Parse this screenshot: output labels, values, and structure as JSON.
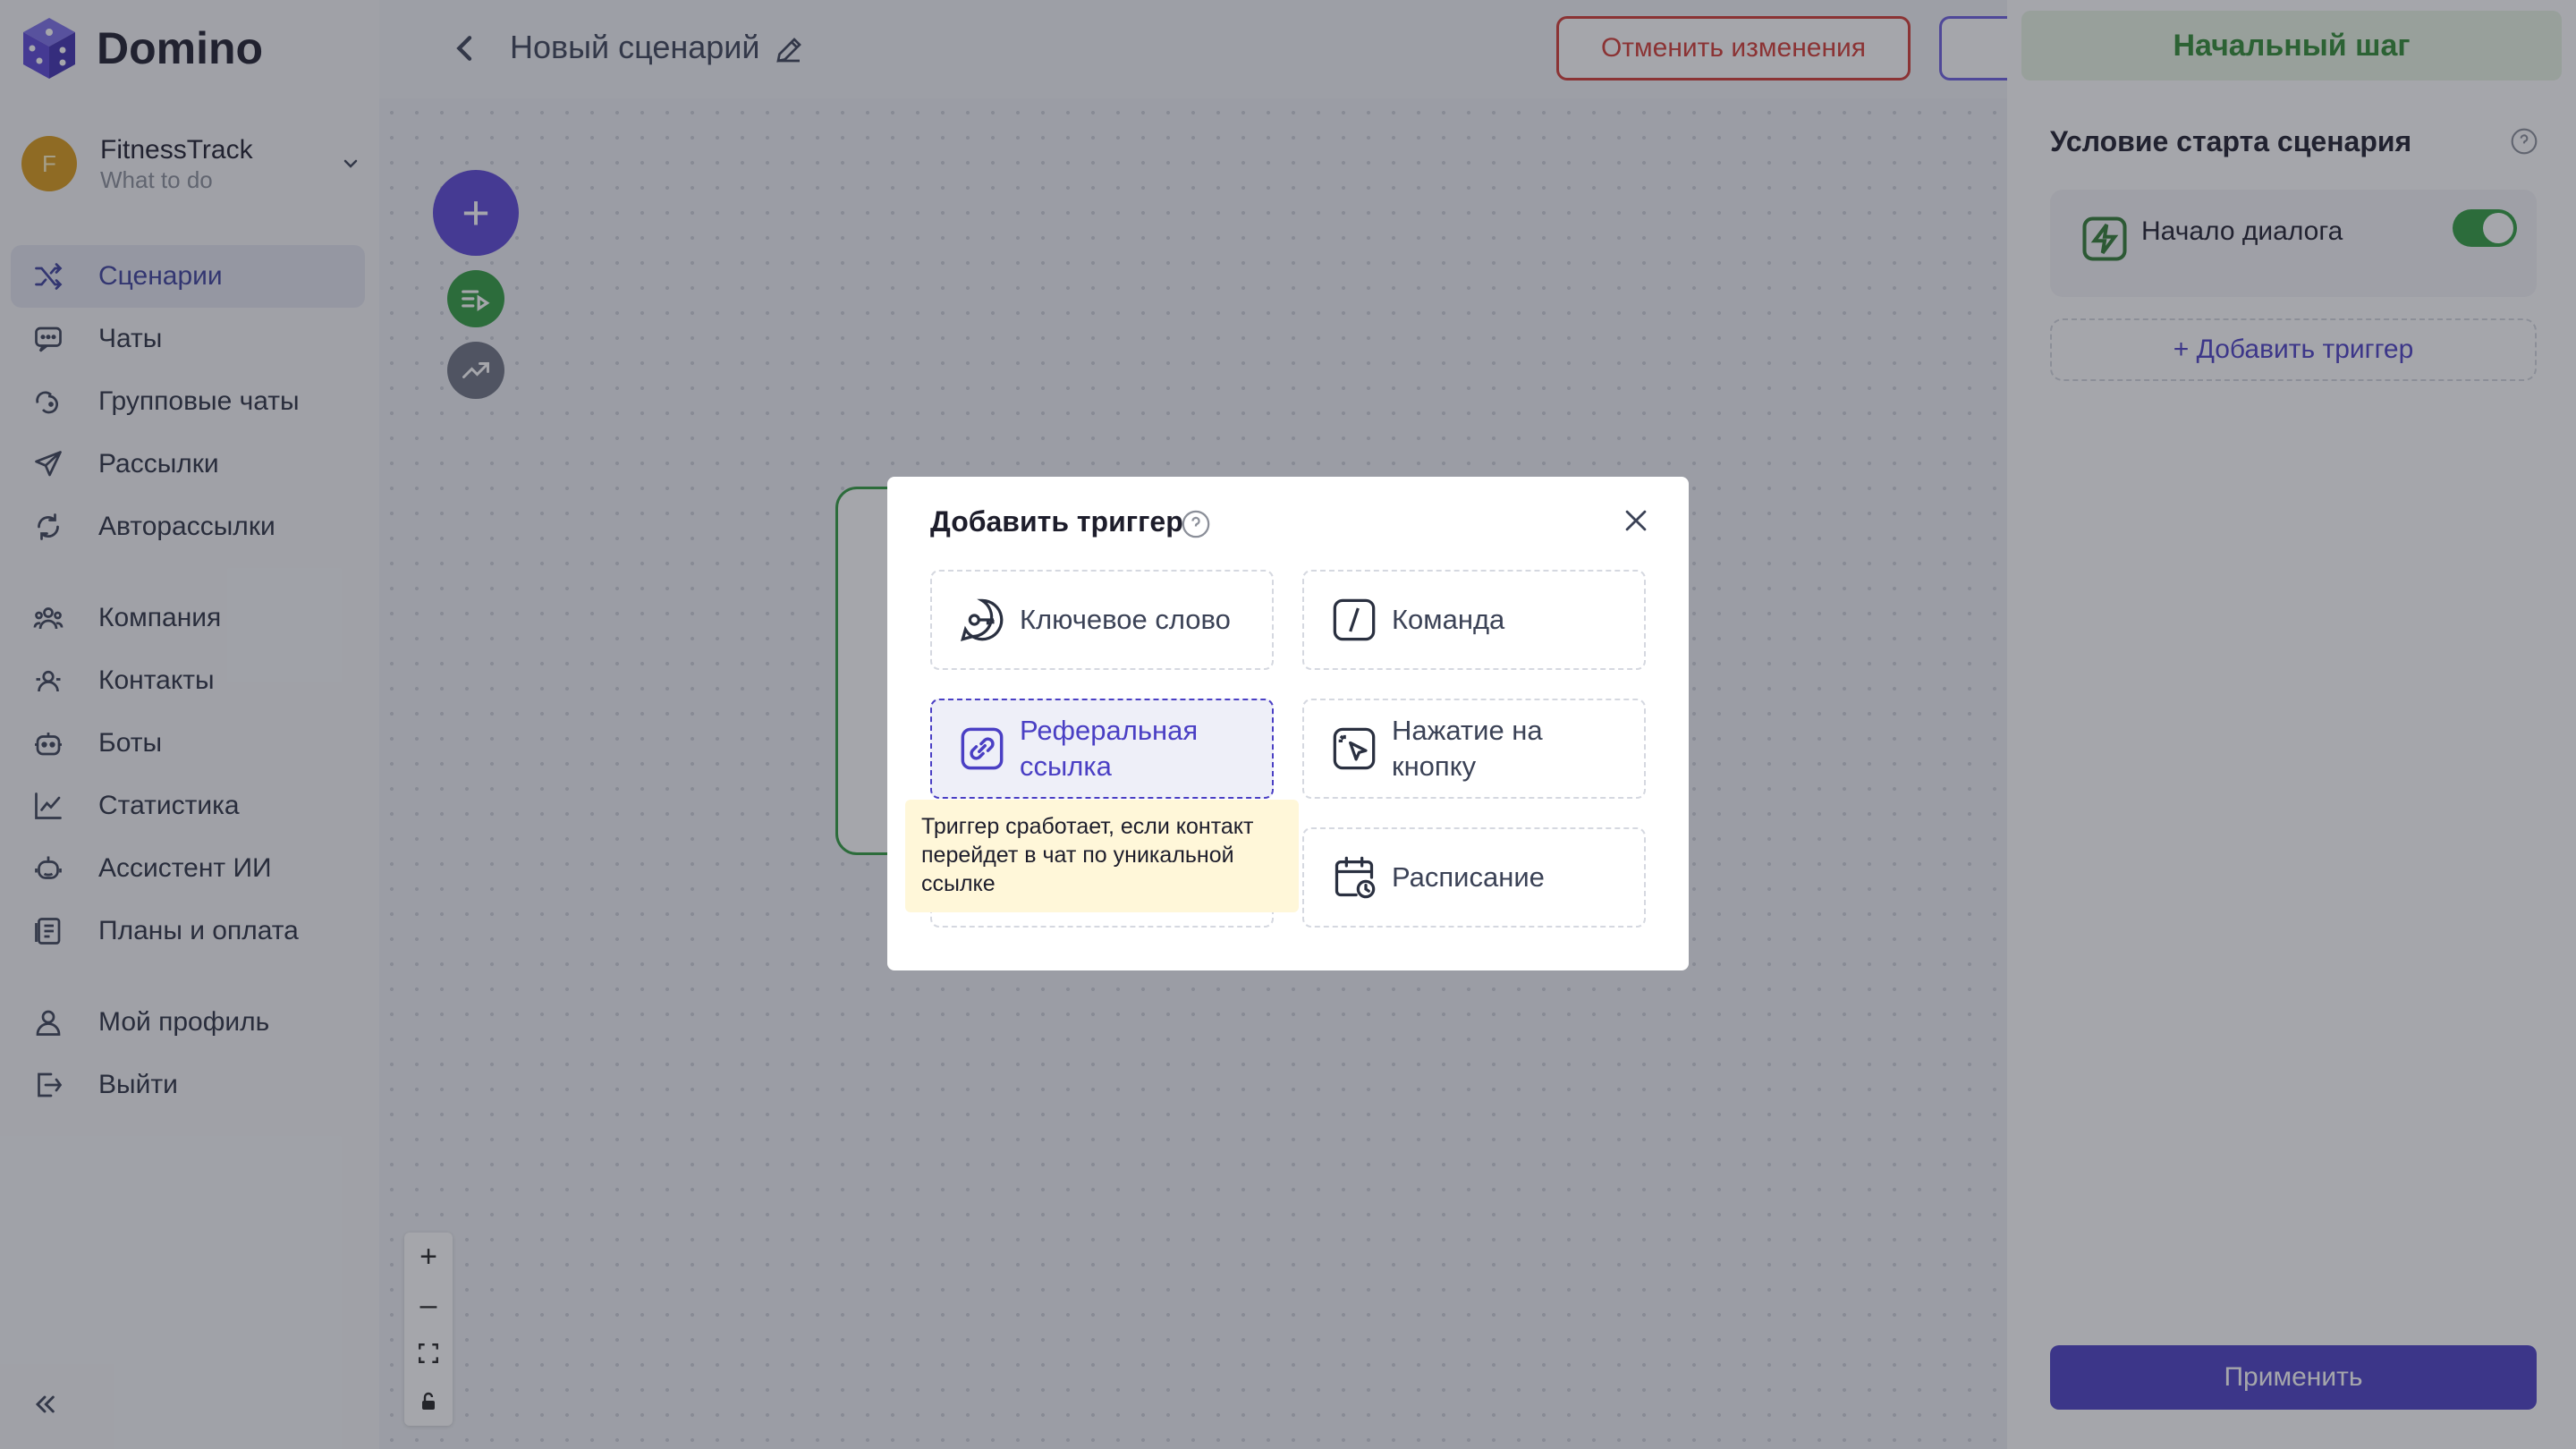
{
  "app": {
    "name": "Domino"
  },
  "project": {
    "initial": "F",
    "name": "FitnessTrack",
    "subtitle": "What to do"
  },
  "nav": [
    {
      "label": "Сценарии",
      "icon": "shuffle-icon",
      "active": true
    },
    {
      "label": "Чаты",
      "icon": "chat-bubble-icon"
    },
    {
      "label": "Групповые чаты",
      "icon": "group-chat-icon"
    },
    {
      "label": "Рассылки",
      "icon": "paper-plane-icon"
    },
    {
      "label": "Авторассылки",
      "icon": "auto-refresh-icon"
    },
    {
      "label": "Компания",
      "icon": "team-icon"
    },
    {
      "label": "Контакты",
      "icon": "contacts-icon"
    },
    {
      "label": "Боты",
      "icon": "bot-icon"
    },
    {
      "label": "Статистика",
      "icon": "chart-line-icon"
    },
    {
      "label": "Ассистент ИИ",
      "icon": "ai-assistant-icon"
    },
    {
      "label": "Планы и оплата",
      "icon": "billing-icon"
    },
    {
      "label": "Мой профиль",
      "icon": "user-icon"
    },
    {
      "label": "Выйти",
      "icon": "logout-icon"
    }
  ],
  "editor": {
    "title": "Новый сценарий",
    "cancel_label": "Отменить изменения",
    "add_label": "+",
    "zoom_in": "+",
    "zoom_out": "–"
  },
  "panel": {
    "header": "Начальный шаг",
    "subtitle": "Условие старта сценария",
    "trigger_label": "Начало диалога",
    "trigger_enabled": true,
    "add_trigger_label": "+ Добавить триггер",
    "apply_label": "Применить"
  },
  "modal": {
    "title": "Добавить триггер",
    "options": [
      {
        "label": "Ключевое слово",
        "icon": "key-chat-icon"
      },
      {
        "label": "Команда",
        "icon": "slash-command-icon"
      },
      {
        "label": "Реферальная ссылка",
        "icon": "link-icon",
        "selected": true
      },
      {
        "label": "Нажатие на кнопку",
        "icon": "click-cursor-icon"
      },
      {
        "label": "Расписание",
        "icon": "calendar-clock-icon"
      }
    ],
    "tooltip": "Триггер сработает, если контакт перейдет в чат по уникальной ссылке"
  },
  "colors": {
    "accent": "#4a3fc4",
    "success": "#2f9b3f",
    "danger": "#d23a32",
    "tooltip_bg": "#fff7d9"
  }
}
